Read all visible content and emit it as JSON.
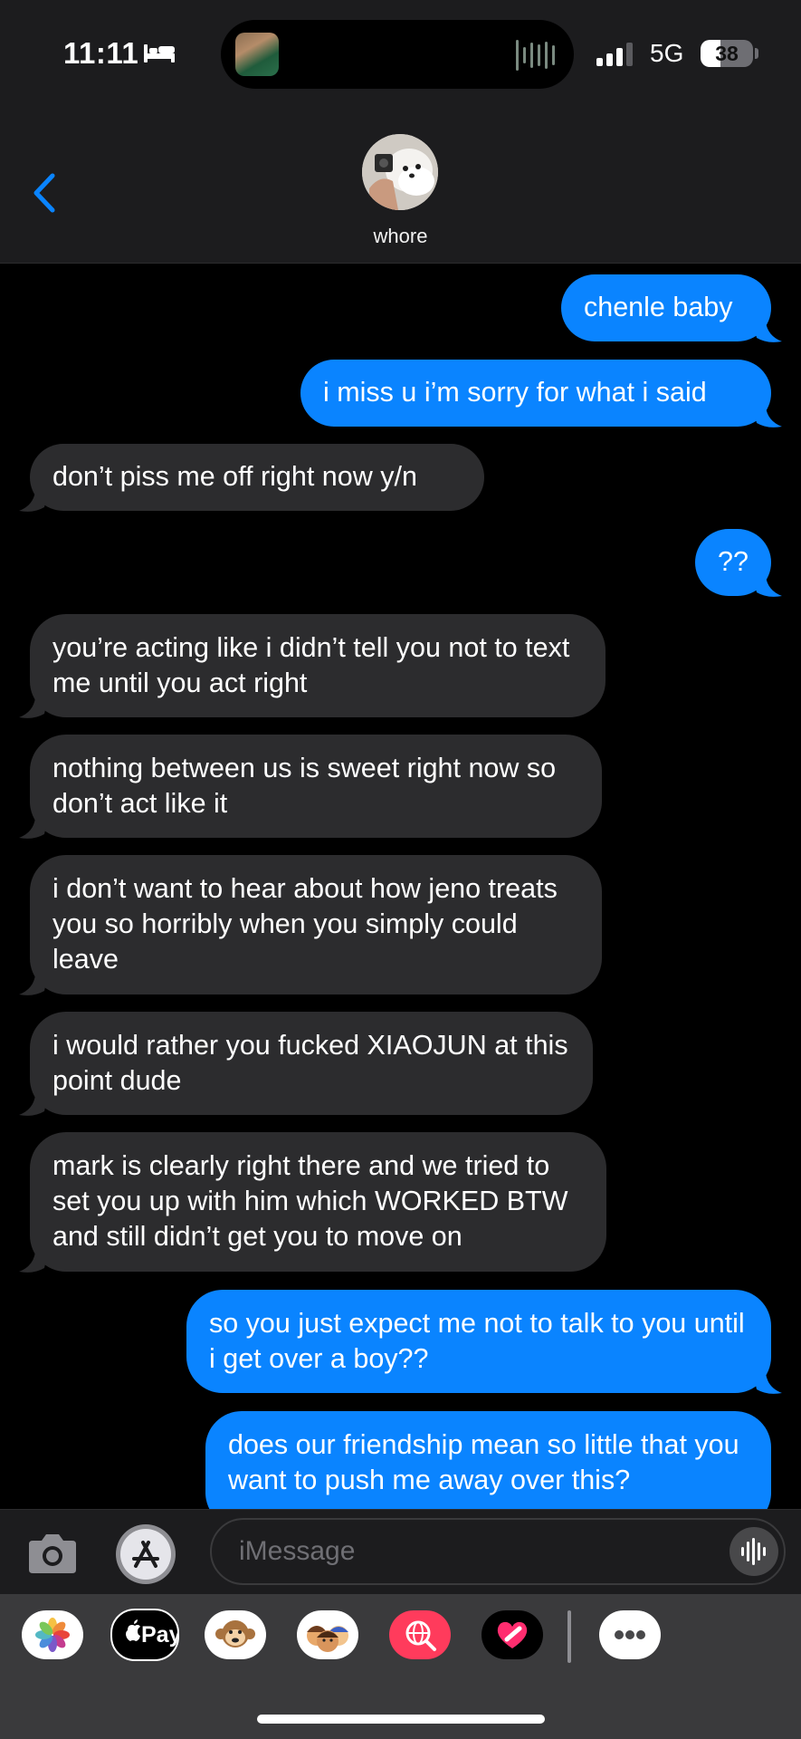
{
  "status_bar": {
    "time": "11:11",
    "network": "5G",
    "battery": "38",
    "battery_level": 0.38
  },
  "header": {
    "contact_name": "whore"
  },
  "messages": [
    {
      "direction": "sent",
      "text": "chenle baby"
    },
    {
      "direction": "sent",
      "text": "i miss u i’m sorry for what i said"
    },
    {
      "direction": "received",
      "text": "don’t piss me off right now y/n"
    },
    {
      "direction": "sent",
      "text": "??"
    },
    {
      "direction": "received",
      "text": "you’re acting like i didn’t tell you not to text me until you act right"
    },
    {
      "direction": "received",
      "text": "nothing between us is sweet right now so don’t act like it"
    },
    {
      "direction": "received",
      "text": "i don’t want to hear about how jeno treats you so horribly when you simply could leave"
    },
    {
      "direction": "received",
      "text": "i would rather you fucked XIAOJUN at this point dude"
    },
    {
      "direction": "received",
      "text": "mark is clearly right there and we tried to set you up with him which WORKED BTW and still didn’t get you to move on"
    },
    {
      "direction": "sent",
      "text": "so you just expect me not to talk to you until i get over a boy??"
    },
    {
      "direction": "sent",
      "text": "does our friendship mean so little that you want to push me away over this?"
    }
  ],
  "composer": {
    "placeholder": "iMessage"
  },
  "app_drawer": {
    "apple_pay_label": "Pay",
    "items": [
      "photos-app",
      "apple-pay-app",
      "animoji-app",
      "memoji-app",
      "web-images-app",
      "digital-touch-app",
      "more-apps"
    ]
  },
  "colors": {
    "sent_bubble": "#0a84ff",
    "received_bubble": "#2c2c2e",
    "header_bg": "#1c1c1e",
    "accent": "#0a84ff"
  }
}
